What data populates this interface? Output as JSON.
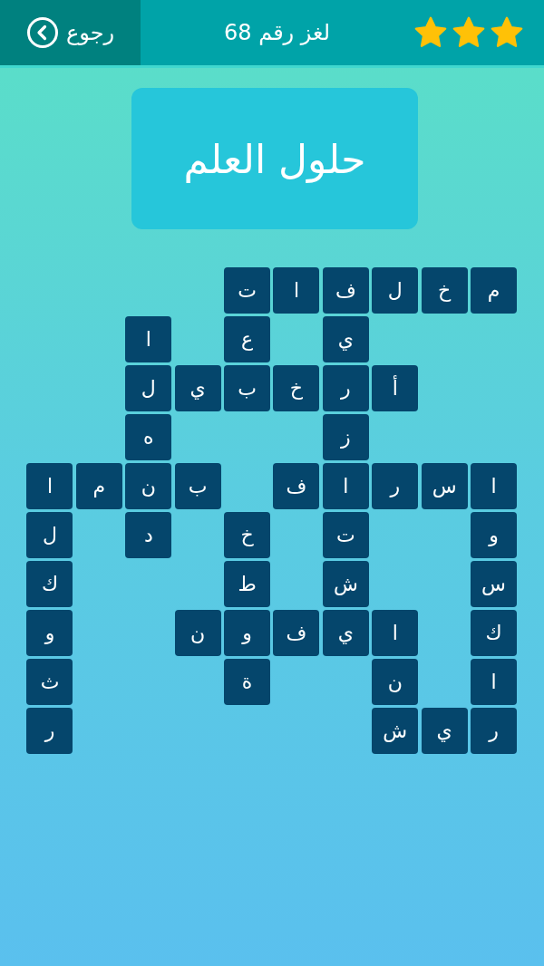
{
  "header": {
    "stars": 3,
    "title": "لغز رقم 68",
    "back_button": {
      "label": "رجوع"
    }
  },
  "clue": "حلول العلم",
  "grid": [
    [
      {
        "kind": "tile",
        "letter": "م"
      },
      {
        "kind": "tile",
        "letter": "خ"
      },
      {
        "kind": "tile",
        "letter": "ل"
      },
      {
        "kind": "tile",
        "letter": "ف"
      },
      {
        "kind": "tile",
        "letter": "ا"
      },
      {
        "kind": "tile",
        "letter": "ت"
      },
      {
        "kind": "gap"
      },
      {
        "kind": "gap"
      },
      {
        "kind": "gap"
      },
      {
        "kind": "gap"
      }
    ],
    [
      {
        "kind": "gap"
      },
      {
        "kind": "gap"
      },
      {
        "kind": "gap"
      },
      {
        "kind": "tile",
        "letter": "ي"
      },
      {
        "kind": "gap"
      },
      {
        "kind": "tile",
        "letter": "ع"
      },
      {
        "kind": "gap"
      },
      {
        "kind": "tile",
        "letter": "ا"
      },
      {
        "kind": "gap"
      },
      {
        "kind": "gap"
      }
    ],
    [
      {
        "kind": "gap"
      },
      {
        "kind": "gap"
      },
      {
        "kind": "tile",
        "letter": "أ"
      },
      {
        "kind": "tile",
        "letter": "ر"
      },
      {
        "kind": "tile",
        "letter": "خ"
      },
      {
        "kind": "tile",
        "letter": "ب"
      },
      {
        "kind": "tile",
        "letter": "ي"
      },
      {
        "kind": "tile",
        "letter": "ل"
      },
      {
        "kind": "gap"
      },
      {
        "kind": "gap"
      }
    ],
    [
      {
        "kind": "gap"
      },
      {
        "kind": "gap"
      },
      {
        "kind": "gap"
      },
      {
        "kind": "tile",
        "letter": "ز"
      },
      {
        "kind": "gap"
      },
      {
        "kind": "gap"
      },
      {
        "kind": "gap"
      },
      {
        "kind": "tile",
        "letter": "ه"
      },
      {
        "kind": "gap"
      },
      {
        "kind": "gap"
      }
    ],
    [
      {
        "kind": "tile",
        "letter": "ا"
      },
      {
        "kind": "tile",
        "letter": "س"
      },
      {
        "kind": "tile",
        "letter": "ر"
      },
      {
        "kind": "tile",
        "letter": "ا"
      },
      {
        "kind": "tile",
        "letter": "ف"
      },
      {
        "kind": "gap"
      },
      {
        "kind": "tile",
        "letter": "ب"
      },
      {
        "kind": "tile",
        "letter": "ن"
      },
      {
        "kind": "tile",
        "letter": "م"
      },
      {
        "kind": "tile",
        "letter": "ا"
      }
    ],
    [
      {
        "kind": "tile",
        "letter": "و"
      },
      {
        "kind": "gap"
      },
      {
        "kind": "gap"
      },
      {
        "kind": "tile",
        "letter": "ت"
      },
      {
        "kind": "gap"
      },
      {
        "kind": "tile",
        "letter": "خ"
      },
      {
        "kind": "gap"
      },
      {
        "kind": "tile",
        "letter": "د"
      },
      {
        "kind": "gap"
      },
      {
        "kind": "tile",
        "letter": "ل"
      }
    ],
    [
      {
        "kind": "tile",
        "letter": "س"
      },
      {
        "kind": "gap"
      },
      {
        "kind": "gap"
      },
      {
        "kind": "tile",
        "letter": "ش"
      },
      {
        "kind": "gap"
      },
      {
        "kind": "tile",
        "letter": "ط"
      },
      {
        "kind": "gap"
      },
      {
        "kind": "gap"
      },
      {
        "kind": "gap"
      },
      {
        "kind": "tile",
        "letter": "ك"
      }
    ],
    [
      {
        "kind": "tile",
        "letter": "ك"
      },
      {
        "kind": "gap"
      },
      {
        "kind": "tile",
        "letter": "ا"
      },
      {
        "kind": "tile",
        "letter": "ي"
      },
      {
        "kind": "tile",
        "letter": "ف"
      },
      {
        "kind": "tile",
        "letter": "و"
      },
      {
        "kind": "tile",
        "letter": "ن"
      },
      {
        "kind": "gap"
      },
      {
        "kind": "gap"
      },
      {
        "kind": "tile",
        "letter": "و"
      }
    ],
    [
      {
        "kind": "tile",
        "letter": "ا"
      },
      {
        "kind": "gap"
      },
      {
        "kind": "tile",
        "letter": "ن"
      },
      {
        "kind": "gap"
      },
      {
        "kind": "gap"
      },
      {
        "kind": "tile",
        "letter": "ة"
      },
      {
        "kind": "gap"
      },
      {
        "kind": "gap"
      },
      {
        "kind": "gap"
      },
      {
        "kind": "tile",
        "letter": "ث"
      }
    ],
    [
      {
        "kind": "tile",
        "letter": "ر"
      },
      {
        "kind": "tile",
        "letter": "ي"
      },
      {
        "kind": "tile",
        "letter": "ش"
      },
      {
        "kind": "gap"
      },
      {
        "kind": "gap"
      },
      {
        "kind": "gap"
      },
      {
        "kind": "gap"
      },
      {
        "kind": "gap"
      },
      {
        "kind": "gap"
      },
      {
        "kind": "tile",
        "letter": "ر"
      }
    ]
  ]
}
